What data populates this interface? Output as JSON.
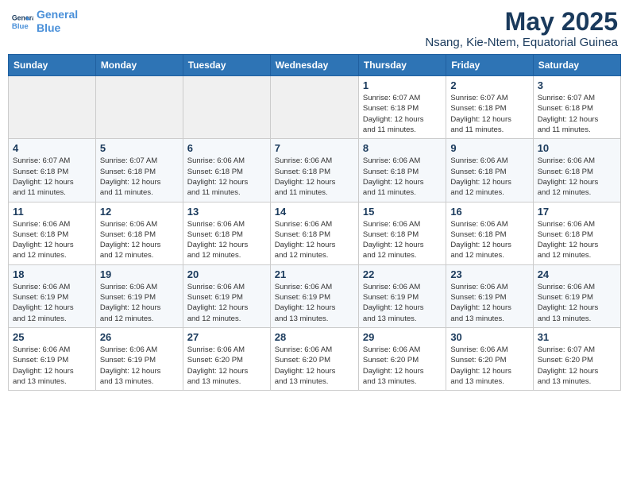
{
  "header": {
    "logo_line1": "General",
    "logo_line2": "Blue",
    "month": "May 2025",
    "location": "Nsang, Kie-Ntem, Equatorial Guinea"
  },
  "days_of_week": [
    "Sunday",
    "Monday",
    "Tuesday",
    "Wednesday",
    "Thursday",
    "Friday",
    "Saturday"
  ],
  "weeks": [
    [
      {
        "num": "",
        "info": ""
      },
      {
        "num": "",
        "info": ""
      },
      {
        "num": "",
        "info": ""
      },
      {
        "num": "",
        "info": ""
      },
      {
        "num": "1",
        "info": "Sunrise: 6:07 AM\nSunset: 6:18 PM\nDaylight: 12 hours\nand 11 minutes."
      },
      {
        "num": "2",
        "info": "Sunrise: 6:07 AM\nSunset: 6:18 PM\nDaylight: 12 hours\nand 11 minutes."
      },
      {
        "num": "3",
        "info": "Sunrise: 6:07 AM\nSunset: 6:18 PM\nDaylight: 12 hours\nand 11 minutes."
      }
    ],
    [
      {
        "num": "4",
        "info": "Sunrise: 6:07 AM\nSunset: 6:18 PM\nDaylight: 12 hours\nand 11 minutes."
      },
      {
        "num": "5",
        "info": "Sunrise: 6:07 AM\nSunset: 6:18 PM\nDaylight: 12 hours\nand 11 minutes."
      },
      {
        "num": "6",
        "info": "Sunrise: 6:06 AM\nSunset: 6:18 PM\nDaylight: 12 hours\nand 11 minutes."
      },
      {
        "num": "7",
        "info": "Sunrise: 6:06 AM\nSunset: 6:18 PM\nDaylight: 12 hours\nand 11 minutes."
      },
      {
        "num": "8",
        "info": "Sunrise: 6:06 AM\nSunset: 6:18 PM\nDaylight: 12 hours\nand 11 minutes."
      },
      {
        "num": "9",
        "info": "Sunrise: 6:06 AM\nSunset: 6:18 PM\nDaylight: 12 hours\nand 12 minutes."
      },
      {
        "num": "10",
        "info": "Sunrise: 6:06 AM\nSunset: 6:18 PM\nDaylight: 12 hours\nand 12 minutes."
      }
    ],
    [
      {
        "num": "11",
        "info": "Sunrise: 6:06 AM\nSunset: 6:18 PM\nDaylight: 12 hours\nand 12 minutes."
      },
      {
        "num": "12",
        "info": "Sunrise: 6:06 AM\nSunset: 6:18 PM\nDaylight: 12 hours\nand 12 minutes."
      },
      {
        "num": "13",
        "info": "Sunrise: 6:06 AM\nSunset: 6:18 PM\nDaylight: 12 hours\nand 12 minutes."
      },
      {
        "num": "14",
        "info": "Sunrise: 6:06 AM\nSunset: 6:18 PM\nDaylight: 12 hours\nand 12 minutes."
      },
      {
        "num": "15",
        "info": "Sunrise: 6:06 AM\nSunset: 6:18 PM\nDaylight: 12 hours\nand 12 minutes."
      },
      {
        "num": "16",
        "info": "Sunrise: 6:06 AM\nSunset: 6:18 PM\nDaylight: 12 hours\nand 12 minutes."
      },
      {
        "num": "17",
        "info": "Sunrise: 6:06 AM\nSunset: 6:18 PM\nDaylight: 12 hours\nand 12 minutes."
      }
    ],
    [
      {
        "num": "18",
        "info": "Sunrise: 6:06 AM\nSunset: 6:19 PM\nDaylight: 12 hours\nand 12 minutes."
      },
      {
        "num": "19",
        "info": "Sunrise: 6:06 AM\nSunset: 6:19 PM\nDaylight: 12 hours\nand 12 minutes."
      },
      {
        "num": "20",
        "info": "Sunrise: 6:06 AM\nSunset: 6:19 PM\nDaylight: 12 hours\nand 12 minutes."
      },
      {
        "num": "21",
        "info": "Sunrise: 6:06 AM\nSunset: 6:19 PM\nDaylight: 12 hours\nand 13 minutes."
      },
      {
        "num": "22",
        "info": "Sunrise: 6:06 AM\nSunset: 6:19 PM\nDaylight: 12 hours\nand 13 minutes."
      },
      {
        "num": "23",
        "info": "Sunrise: 6:06 AM\nSunset: 6:19 PM\nDaylight: 12 hours\nand 13 minutes."
      },
      {
        "num": "24",
        "info": "Sunrise: 6:06 AM\nSunset: 6:19 PM\nDaylight: 12 hours\nand 13 minutes."
      }
    ],
    [
      {
        "num": "25",
        "info": "Sunrise: 6:06 AM\nSunset: 6:19 PM\nDaylight: 12 hours\nand 13 minutes."
      },
      {
        "num": "26",
        "info": "Sunrise: 6:06 AM\nSunset: 6:19 PM\nDaylight: 12 hours\nand 13 minutes."
      },
      {
        "num": "27",
        "info": "Sunrise: 6:06 AM\nSunset: 6:20 PM\nDaylight: 12 hours\nand 13 minutes."
      },
      {
        "num": "28",
        "info": "Sunrise: 6:06 AM\nSunset: 6:20 PM\nDaylight: 12 hours\nand 13 minutes."
      },
      {
        "num": "29",
        "info": "Sunrise: 6:06 AM\nSunset: 6:20 PM\nDaylight: 12 hours\nand 13 minutes."
      },
      {
        "num": "30",
        "info": "Sunrise: 6:06 AM\nSunset: 6:20 PM\nDaylight: 12 hours\nand 13 minutes."
      },
      {
        "num": "31",
        "info": "Sunrise: 6:07 AM\nSunset: 6:20 PM\nDaylight: 12 hours\nand 13 minutes."
      }
    ]
  ]
}
